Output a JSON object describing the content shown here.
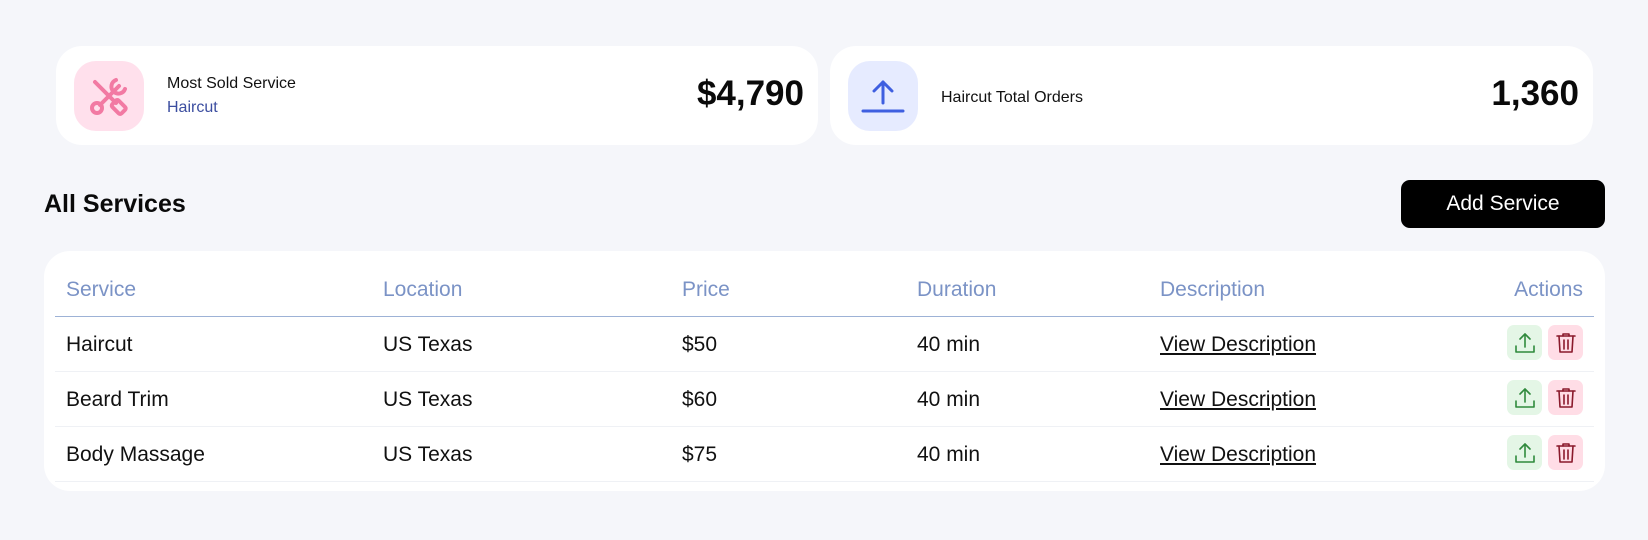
{
  "stats": {
    "most_sold": {
      "label": "Most Sold Service",
      "service": "Haircut",
      "value": "$4,790",
      "icon": "tools-icon",
      "icon_color": "#f27aa3",
      "icon_bg": "#ffe0ec"
    },
    "total_orders": {
      "label": "Haircut Total Orders",
      "value": "1,360",
      "icon": "upload-arrow-icon",
      "icon_color": "#3f5fe0",
      "icon_bg": "#e6ebff"
    }
  },
  "section": {
    "title": "All Services",
    "add_button": "Add Service"
  },
  "table": {
    "headers": [
      "Service",
      "Location",
      "Price",
      "Duration",
      "Description",
      "Actions"
    ],
    "rows": [
      {
        "service": "Haircut",
        "location": "US Texas",
        "price": "$50",
        "duration": "40 min",
        "description": "View Description"
      },
      {
        "service": "Beard Trim",
        "location": "US Texas",
        "price": "$60",
        "duration": "40 min",
        "description": "View Description"
      },
      {
        "service": "Body Massage",
        "location": "US Texas",
        "price": "$75",
        "duration": "40 min",
        "description": "View Description"
      }
    ],
    "action_icons": [
      "upload-icon",
      "trash-icon"
    ]
  },
  "colors": {
    "background": "#f5f6fa",
    "header_text": "#7b93c6",
    "upload_action": "#2f8a3c",
    "delete_action": "#8a1a2c"
  }
}
